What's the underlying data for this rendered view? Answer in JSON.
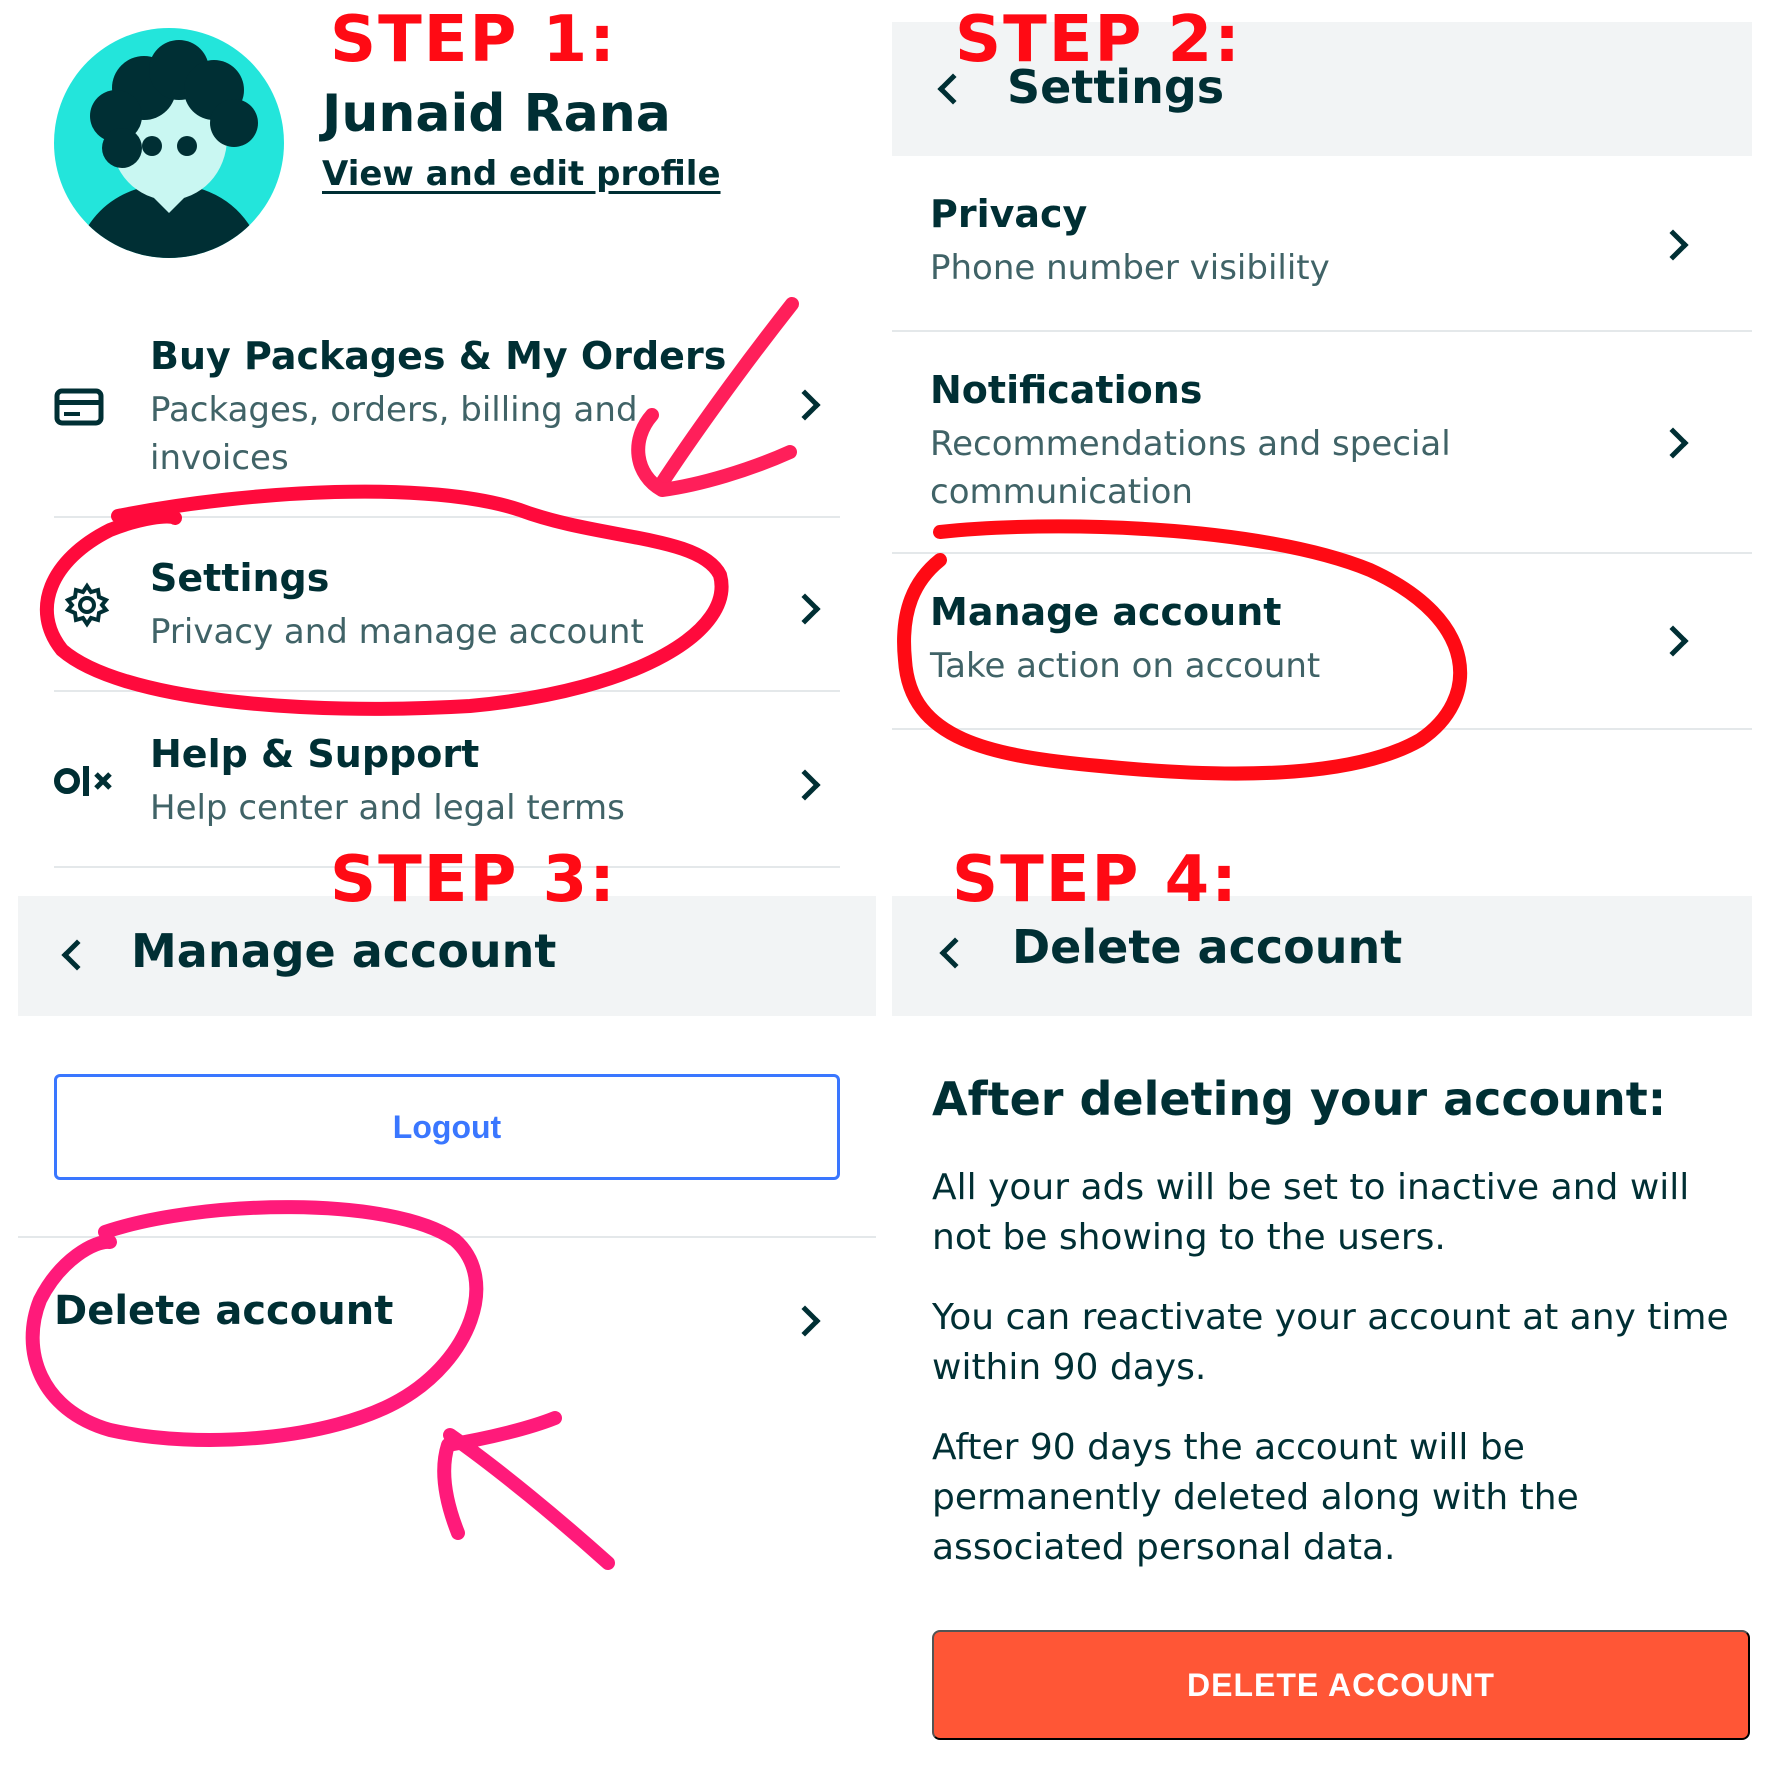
{
  "steps": {
    "step1": "STEP 1:",
    "step2": "STEP 2:",
    "step3": "STEP 3:",
    "step4": "STEP 4:"
  },
  "profile": {
    "name": "Junaid Rana",
    "edit_link": "View and edit profile"
  },
  "menu": {
    "items": [
      {
        "title": "Buy Packages & My Orders",
        "subtitle": "Packages, orders, billing and invoices",
        "icon": "credit-card-icon"
      },
      {
        "title": "Settings",
        "subtitle": "Privacy and manage account",
        "icon": "gear-icon"
      },
      {
        "title": "Help & Support",
        "subtitle": "Help center and legal terms",
        "icon": "olx-logo-icon"
      }
    ]
  },
  "settings_screen": {
    "title": "Settings",
    "items": [
      {
        "title": "Privacy",
        "subtitle": "Phone number visibility"
      },
      {
        "title": "Notifications",
        "subtitle": "Recommendations and special communication"
      },
      {
        "title": "Manage account",
        "subtitle": "Take action on account"
      }
    ]
  },
  "manage_screen": {
    "title": "Manage account",
    "logout_label": "Logout",
    "delete_label": "Delete account"
  },
  "delete_screen": {
    "title": "Delete account",
    "heading": "After deleting your account:",
    "paragraphs": [
      "All your ads will be set to inactive and will not be showing to the users.",
      "You can reactivate your account at any time within 90 days.",
      "After 90 days the account will be permanently deleted along with the associated personal data."
    ],
    "button_label": "DELETE ACCOUNT"
  },
  "colors": {
    "text": "#002f34",
    "secondary_text": "#406367",
    "header_bg": "#f2f4f5",
    "avatar_bg": "#23e5db",
    "link_blue": "#3a77ff",
    "delete_orange": "#ff5636",
    "annotation_red": "#ff0a14",
    "annotation_pink": "#ff1f6b"
  }
}
